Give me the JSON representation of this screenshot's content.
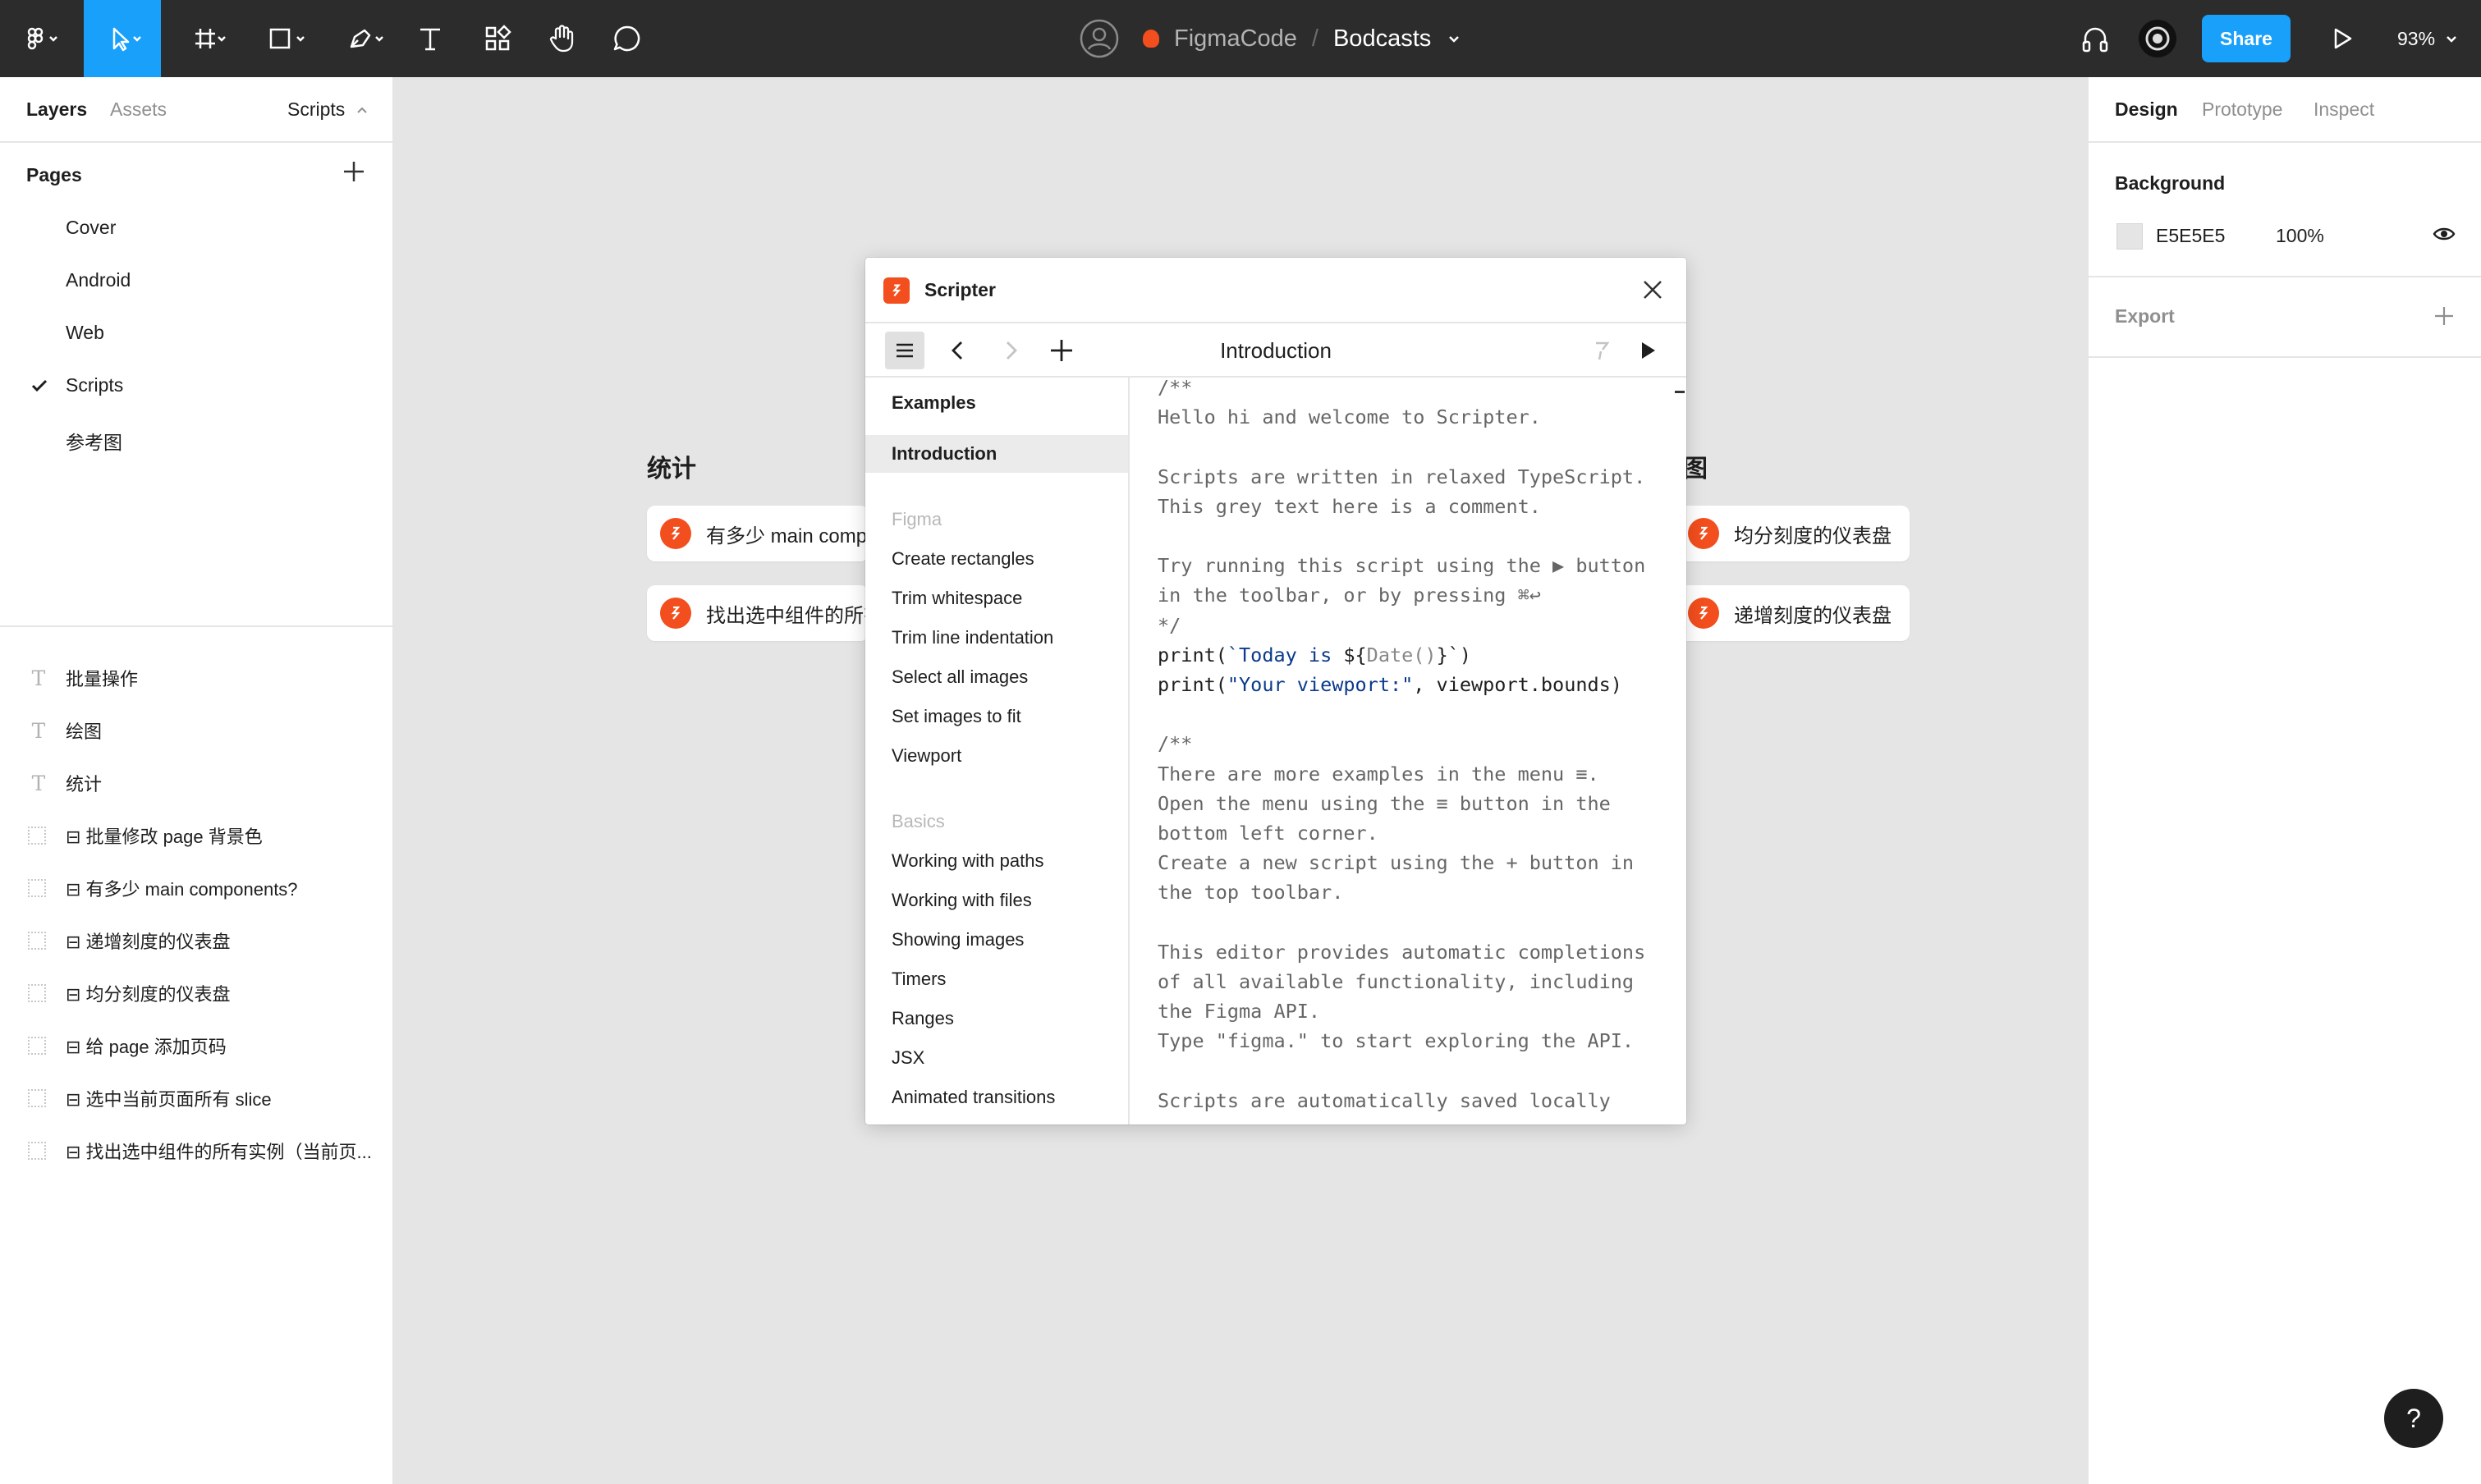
{
  "toolbar": {
    "file_project": "FigmaCode",
    "separator": "/",
    "file_name": "Bodcasts",
    "share_label": "Share",
    "zoom": "93%"
  },
  "left_panel": {
    "tabs": [
      "Layers",
      "Assets"
    ],
    "scripts_tab": "Scripts",
    "pages_header": "Pages",
    "pages": [
      "Cover",
      "Android",
      "Web",
      "Scripts",
      "参考图"
    ],
    "current_page_index": 3,
    "layers": [
      {
        "type": "text",
        "name": "批量操作"
      },
      {
        "type": "text",
        "name": "绘图"
      },
      {
        "type": "text",
        "name": "统计"
      },
      {
        "type": "frame",
        "name": "⊟ 批量修改 page 背景色"
      },
      {
        "type": "frame",
        "name": "⊟ 有多少 main components?"
      },
      {
        "type": "frame",
        "name": "⊟ 递增刻度的仪表盘"
      },
      {
        "type": "frame",
        "name": "⊟ 均分刻度的仪表盘"
      },
      {
        "type": "frame",
        "name": "⊟ 给 page 添加页码"
      },
      {
        "type": "frame",
        "name": "⊟ 选中当前页面所有 slice"
      },
      {
        "type": "frame",
        "name": "⊟ 找出选中组件的所有实例（当前页..."
      }
    ]
  },
  "right_panel": {
    "tabs": [
      "Design",
      "Prototype",
      "Inspect"
    ],
    "background_title": "Background",
    "background_hex": "E5E5E5",
    "background_opacity": "100%",
    "export_title": "Export"
  },
  "canvas": {
    "heading_left": "统计",
    "heading_right": "绘图",
    "cards_left": [
      "有多少 main components?",
      "找出选中组件的所有实例"
    ],
    "cards_right": [
      "均分刻度的仪表盘",
      "递增刻度的仪表盘"
    ]
  },
  "scripter": {
    "title": "Scripter",
    "doc_title": "Introduction",
    "sidebar": [
      {
        "label": "Examples",
        "kind": "bold"
      },
      {
        "label": "Introduction",
        "kind": "selected"
      },
      {
        "label": "Figma",
        "kind": "header"
      },
      {
        "label": "Create rectangles",
        "kind": "item"
      },
      {
        "label": "Trim whitespace",
        "kind": "item"
      },
      {
        "label": "Trim line indentation",
        "kind": "item"
      },
      {
        "label": "Select all images",
        "kind": "item"
      },
      {
        "label": "Set images to fit",
        "kind": "item"
      },
      {
        "label": "Viewport",
        "kind": "item"
      },
      {
        "label": "Basics",
        "kind": "header"
      },
      {
        "label": "Working with paths",
        "kind": "item"
      },
      {
        "label": "Working with files",
        "kind": "item"
      },
      {
        "label": "Showing images",
        "kind": "item"
      },
      {
        "label": "Timers",
        "kind": "item"
      },
      {
        "label": "Ranges",
        "kind": "item"
      },
      {
        "label": "JSX",
        "kind": "item"
      },
      {
        "label": "Animated transitions",
        "kind": "item"
      }
    ],
    "code": [
      {
        "text": "/**",
        "kind": "comment"
      },
      {
        "text": "Hello hi and welcome to Scripter.",
        "kind": "comment"
      },
      {
        "text": "",
        "kind": "comment"
      },
      {
        "text": "Scripts are written in relaxed TypeScript.",
        "kind": "comment"
      },
      {
        "text": "This grey text here is a comment.",
        "kind": "comment"
      },
      {
        "text": "",
        "kind": "comment"
      },
      {
        "text": "Try running this script using the ▶ button",
        "kind": "comment"
      },
      {
        "text": "in the toolbar, or by pressing ⌘↩",
        "kind": "comment"
      },
      {
        "text": "*/",
        "kind": "comment"
      },
      {
        "text": "print(`Today is ${Date()}`)",
        "kind": "code1"
      },
      {
        "text": "print(\"Your viewport:\", viewport.bounds)",
        "kind": "code2"
      },
      {
        "text": "",
        "kind": "comment"
      },
      {
        "text": "/**",
        "kind": "comment"
      },
      {
        "text": "There are more examples in the menu ≡.",
        "kind": "comment"
      },
      {
        "text": "Open the menu using the ≡ button in the",
        "kind": "comment"
      },
      {
        "text": "bottom left corner.",
        "kind": "comment"
      },
      {
        "text": "Create a new script using the + button in",
        "kind": "comment"
      },
      {
        "text": "the top toolbar.",
        "kind": "comment"
      },
      {
        "text": "",
        "kind": "comment"
      },
      {
        "text": "This editor provides automatic completions",
        "kind": "comment"
      },
      {
        "text": "of all available functionality, including",
        "kind": "comment"
      },
      {
        "text": "the Figma API.",
        "kind": "comment"
      },
      {
        "text": "Type \"figma.\" to start exploring the API.",
        "kind": "comment"
      },
      {
        "text": "",
        "kind": "comment"
      },
      {
        "text": "Scripts are automatically saved locally",
        "kind": "comment"
      }
    ]
  },
  "help_label": "?",
  "colors": {
    "accent": "#18a0fb",
    "toolbar_bg": "#2c2c2c",
    "canvas_bg": "#e5e5e5",
    "scripter_red": "#f24e1e"
  },
  "icons": {
    "toolbar": [
      "figma-menu-icon",
      "move-tool-icon",
      "frame-tool-icon",
      "shape-tool-icon",
      "pen-tool-icon",
      "text-tool-icon",
      "resources-icon",
      "hand-tool-icon",
      "comment-tool-icon",
      "user-avatar-icon",
      "audio-icon",
      "multiplayer-icon",
      "present-play-icon"
    ]
  }
}
